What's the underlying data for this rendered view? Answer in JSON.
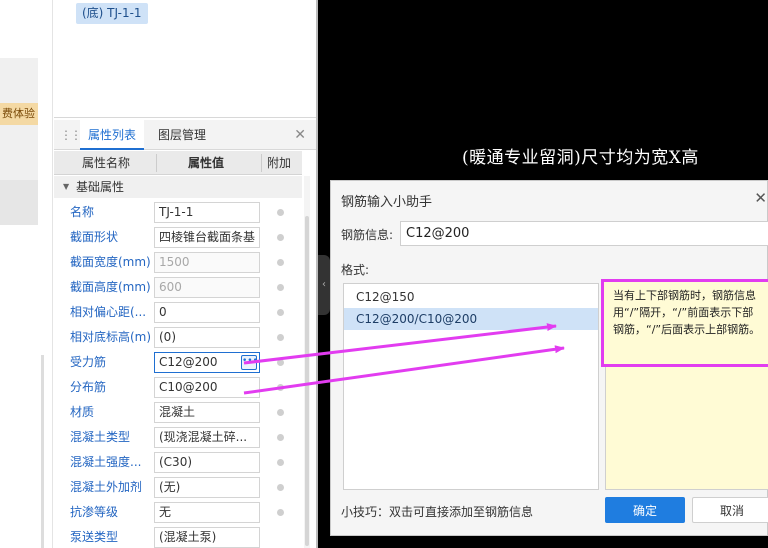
{
  "left": {
    "badge": "费体验"
  },
  "tree": {
    "node_label": "(底) TJ-1-1"
  },
  "panel": {
    "tab_properties": "属性列表",
    "tab_layers": "图层管理",
    "col_name": "属性名称",
    "col_value": "属性值",
    "col_extra": "附加",
    "group": "基础属性",
    "rows": [
      {
        "name": "名称",
        "value": "TJ-1-1",
        "disabled": false
      },
      {
        "name": "截面形状",
        "value": "四棱锥台截面条基",
        "disabled": false
      },
      {
        "name": "截面宽度(mm)",
        "value": "1500",
        "disabled": true
      },
      {
        "name": "截面高度(mm)",
        "value": "600",
        "disabled": true
      },
      {
        "name": "相对偏心距(...",
        "value": "0",
        "disabled": false
      },
      {
        "name": "相对底标高(m)",
        "value": "(0)",
        "disabled": false
      },
      {
        "name": "受力筋",
        "value": "C12@200",
        "disabled": false
      },
      {
        "name": "分布筋",
        "value": "C10@200",
        "disabled": false
      },
      {
        "name": "材质",
        "value": "混凝土",
        "disabled": false
      },
      {
        "name": "混凝土类型",
        "value": "(现浇混凝土碎...",
        "disabled": false
      },
      {
        "name": "混凝土强度...",
        "value": "(C30)",
        "disabled": false
      },
      {
        "name": "混凝土外加剂",
        "value": "(无)",
        "disabled": false
      },
      {
        "name": "抗渗等级",
        "value": "无",
        "disabled": false
      },
      {
        "name": "泵送类型",
        "value": "(混凝土泵)",
        "disabled": false
      }
    ]
  },
  "canvas": {
    "annotation": "(暖通专业留洞)尺寸均为宽X高"
  },
  "dialog": {
    "title": "钢筋输入小助手",
    "info_label": "钢筋信息:",
    "info_value": "C12@200",
    "format_label": "格式:",
    "formats": [
      "C12@150",
      "C12@200/C10@200"
    ],
    "hint": "当有上下部钢筋时，钢筋信息用“/”隔开，“/”前面表示下部钢筋，“/”后面表示上部钢筋。",
    "tip": "小技巧：双击可直接添加至钢筋信息",
    "ok": "确定",
    "cancel": "取消"
  },
  "colors": {
    "accent": "#1f7de0",
    "arrow": "#e23cf0",
    "hint_bg": "#fffbd5"
  }
}
